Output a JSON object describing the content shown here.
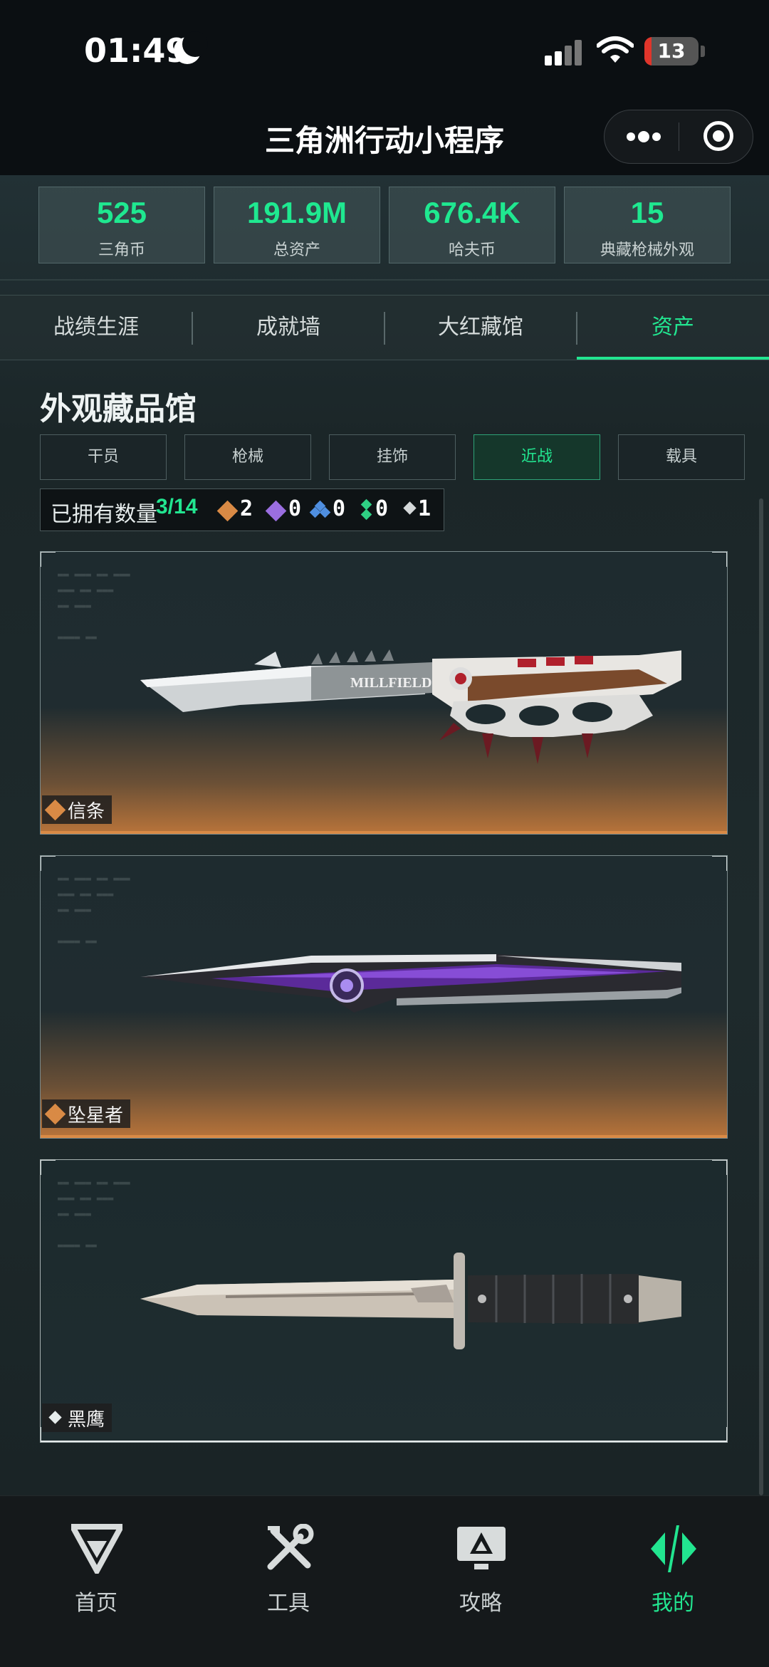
{
  "status": {
    "time": "01:49",
    "battery": "13"
  },
  "header": {
    "title": "三角洲行动小程序"
  },
  "stats": [
    {
      "value": "525",
      "label": "三角币"
    },
    {
      "value": "191.9M",
      "label": "总资产"
    },
    {
      "value": "676.4K",
      "label": "哈夫币"
    },
    {
      "value": "15",
      "label": "典藏枪械外观"
    }
  ],
  "tabs": [
    {
      "label": "战绩生涯",
      "active": false
    },
    {
      "label": "成就墙",
      "active": false
    },
    {
      "label": "大红藏馆",
      "active": false
    },
    {
      "label": "资产",
      "active": true
    }
  ],
  "section": {
    "title": "外观藏品馆"
  },
  "filters": [
    {
      "label": "干员",
      "active": false
    },
    {
      "label": "枪械",
      "active": false
    },
    {
      "label": "挂饰",
      "active": false
    },
    {
      "label": "近战",
      "active": true
    },
    {
      "label": "载具",
      "active": false
    }
  ],
  "owned": {
    "label": "已拥有数量",
    "count": "3/14",
    "rarity_counts": [
      {
        "tier": "orange",
        "value": "2"
      },
      {
        "tier": "purple",
        "value": "0"
      },
      {
        "tier": "blue",
        "value": "0"
      },
      {
        "tier": "green",
        "value": "0"
      },
      {
        "tier": "white",
        "value": "1"
      }
    ]
  },
  "items": [
    {
      "name": "信条",
      "tier": "orange",
      "weapon_text": "MILLFIELD"
    },
    {
      "name": "坠星者",
      "tier": "orange"
    },
    {
      "name": "黑鹰",
      "tier": "white"
    }
  ],
  "bottom_nav": [
    {
      "label": "首页",
      "icon": "delta-logo-icon",
      "active": false
    },
    {
      "label": "工具",
      "icon": "tools-icon",
      "active": false
    },
    {
      "label": "攻略",
      "icon": "guide-monitor-icon",
      "active": false
    },
    {
      "label": "我的",
      "icon": "profile-logo-icon",
      "active": true
    }
  ],
  "colors": {
    "accent": "#22e590",
    "orange_tier": "#d98a45",
    "bg": "#131c1d"
  }
}
